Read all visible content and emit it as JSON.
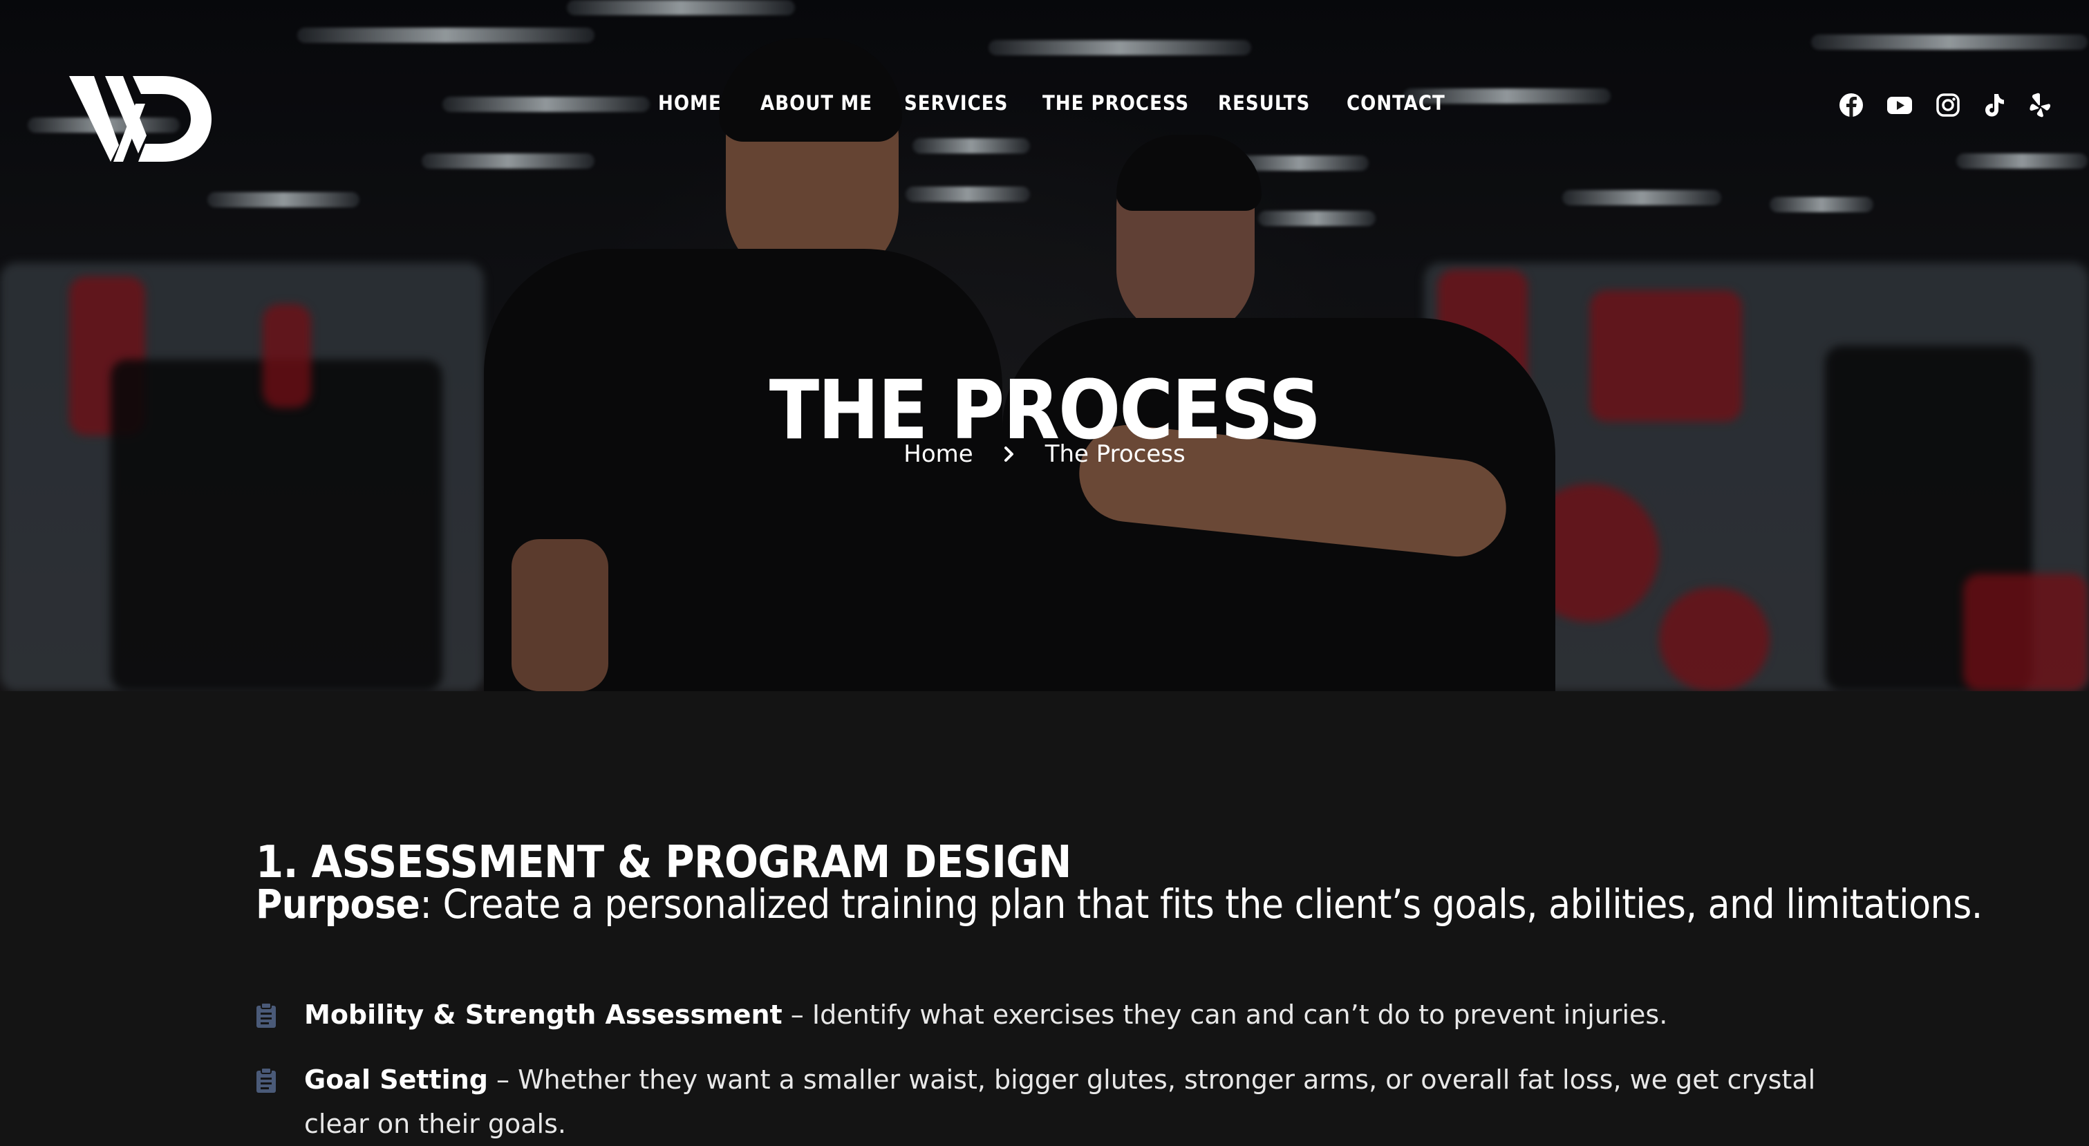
{
  "header": {
    "logo_alt": "VD",
    "nav": [
      {
        "label": "HOME"
      },
      {
        "label": "ABOUT ME"
      },
      {
        "label": "SERVICES"
      },
      {
        "label": "THE PROCESS"
      },
      {
        "label": "RESULTS"
      },
      {
        "label": "CONTACT"
      }
    ],
    "social": [
      {
        "icon": "facebook-icon"
      },
      {
        "icon": "youtube-icon"
      },
      {
        "icon": "instagram-icon"
      },
      {
        "icon": "tiktok-icon"
      },
      {
        "icon": "yelp-icon"
      }
    ]
  },
  "hero": {
    "title": "THE PROCESS",
    "breadcrumb": {
      "home": "Home",
      "current": "The Process"
    }
  },
  "main": {
    "section_title": "1. ASSESSMENT & PROGRAM DESIGN",
    "purpose_label": "Purpose",
    "purpose_text": ": Create a personalized training plan that fits the client’s goals, abilities, and limitations.",
    "items": [
      {
        "strong": "Mobility & Strength Assessment",
        "text": " – Identify what exercises they can and can’t do to prevent injuries."
      },
      {
        "strong": "Goal Setting",
        "text": " – Whether they want a smaller waist, bigger glutes, stronger arms, or overall fat loss, we get crystal clear on their goals."
      }
    ]
  },
  "colors": {
    "background": "#141414",
    "hero_overlay": "#0b0c10",
    "text": "#ffffff",
    "list_icon": "#4a5a78",
    "gym_red": "#a0141e"
  }
}
